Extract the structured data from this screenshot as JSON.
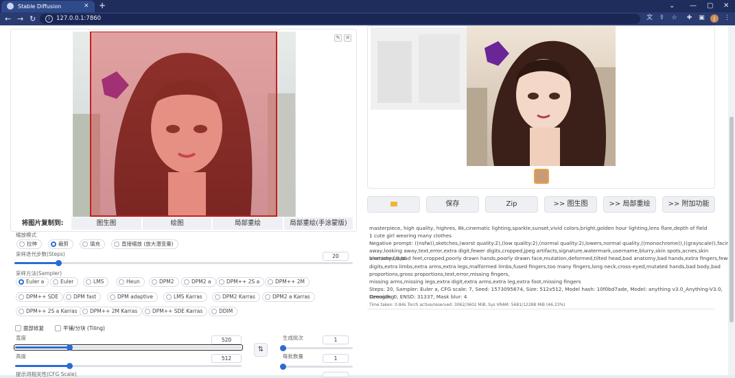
{
  "browser": {
    "tab_title": "Stable Diffusion",
    "new_tab": "+",
    "url": "127.0.0.1:7860",
    "profile_initial": "J",
    "controls": {
      "minimize": "⌄",
      "restore": "—",
      "maximize": "▢",
      "close": "✕"
    }
  },
  "img2img": {
    "copy_label": "将图片复制到:",
    "copy_targets": [
      "图生图",
      "绘图",
      "局部重绘",
      "局部重绘(手涂蒙版)"
    ],
    "resize_mode_label": "缩放模式",
    "resize_modes": [
      "拉伸",
      "裁剪",
      "填充",
      "直接缩放 (放大潜变量)"
    ],
    "resize_selected": 1,
    "steps_label": "采样迭代步数(Steps)",
    "steps_value": "20",
    "steps_fraction": 0.13,
    "sampler_label": "采样方法(Sampler)",
    "samplers_row1": [
      "Euler a",
      "Euler",
      "LMS",
      "Heun",
      "DPM2",
      "DPM2 a",
      "DPM++ 2S a",
      "DPM++ 2M"
    ],
    "samplers_row2": [
      "DPM++ SDE",
      "DPM fast",
      "DPM adaptive",
      "LMS Karras",
      "DPM2 Karras",
      "DPM2 a Karras"
    ],
    "samplers_row3": [
      "DPM++ 2S a Karras",
      "DPM++ 2M Karras",
      "DPM++ SDE Karras",
      "DDIM"
    ],
    "sampler_selected": "Euler a",
    "face_restore_label": "面部修复",
    "tiling_label": "平铺/分块 (Tiling)",
    "width_label": "宽度",
    "width_value": "520",
    "width_fraction": 0.24,
    "height_label": "高度",
    "height_value": "512",
    "height_fraction": 0.24,
    "swap_icon": "⇅",
    "batch_count_label": "生成批次",
    "batch_count_value": "1",
    "batch_size_label": "每批数量",
    "batch_size_value": "1",
    "cfg_label": "提示词相关性(CFG Scale)"
  },
  "output": {
    "buttons": [
      "",
      "保存",
      "Zip",
      ">> 图生图",
      ">> 局部重绘",
      ">> 附加功能"
    ],
    "folder_icon": "folder-icon",
    "info_prompt": "masterpiece, high quality, highres, 8k,cinematic lighting,sparkle,sunset,vivid colors,bright,golden hour lighting,lens flare,depth of field",
    "info_line2": "1 cute girl wearing many clothes",
    "info_negative_1": "Negative prompt: ((nsfw)),sketches,(worst quality:2),(low quality:2),(normal quality:2),lowers,normal quality,((monochrome)),((grayscale)),facing",
    "info_negative_2": "away,looking away,text,error,extra digit,fewer digits,cropped,jpeg artifacts,signature,watermark,username,blurry,skin spots,acnes,skin blemishes,bad",
    "info_negative_3": "anatomy,fat,bad feet,cropped,poorly drawn hands,poorly drawn face,mutation,deformed,tilted head,bad anatomy,bad hands,extra fingers,fewer",
    "info_negative_4": "digits,extra limbs,extra arms,extra legs,malformed limbs,fused fingers,too many fingers,long neck,cross-eyed,mutated hands,bad body,bad",
    "info_negative_5": "proportions,gross proportions,text,error,missing fingers,",
    "info_negative_6": "missing arms,missing legs,extra digit,extra arms,extra leg,extra foot,missing fingers",
    "info_params_1": "Steps: 20, Sampler: Euler a, CFG scale: 7, Seed: 1573095674, Size: 512x512, Model hash: 10f0bd7ade, Model: anything v3.0_Anything-V3.0, Denoising",
    "info_params_2": "strength: 0, ENSD: 31337, Mask blur: 4",
    "info_time": "Time taken: 0.84s  Torch active/reserved: 3062/3602 MiB, Sys VRAM: 5681/12288 MiB (46.23%)"
  },
  "colors": {
    "accent": "#2b6bd6",
    "mask_red": "#d63a3a",
    "chrome": "#1f2d5c"
  }
}
